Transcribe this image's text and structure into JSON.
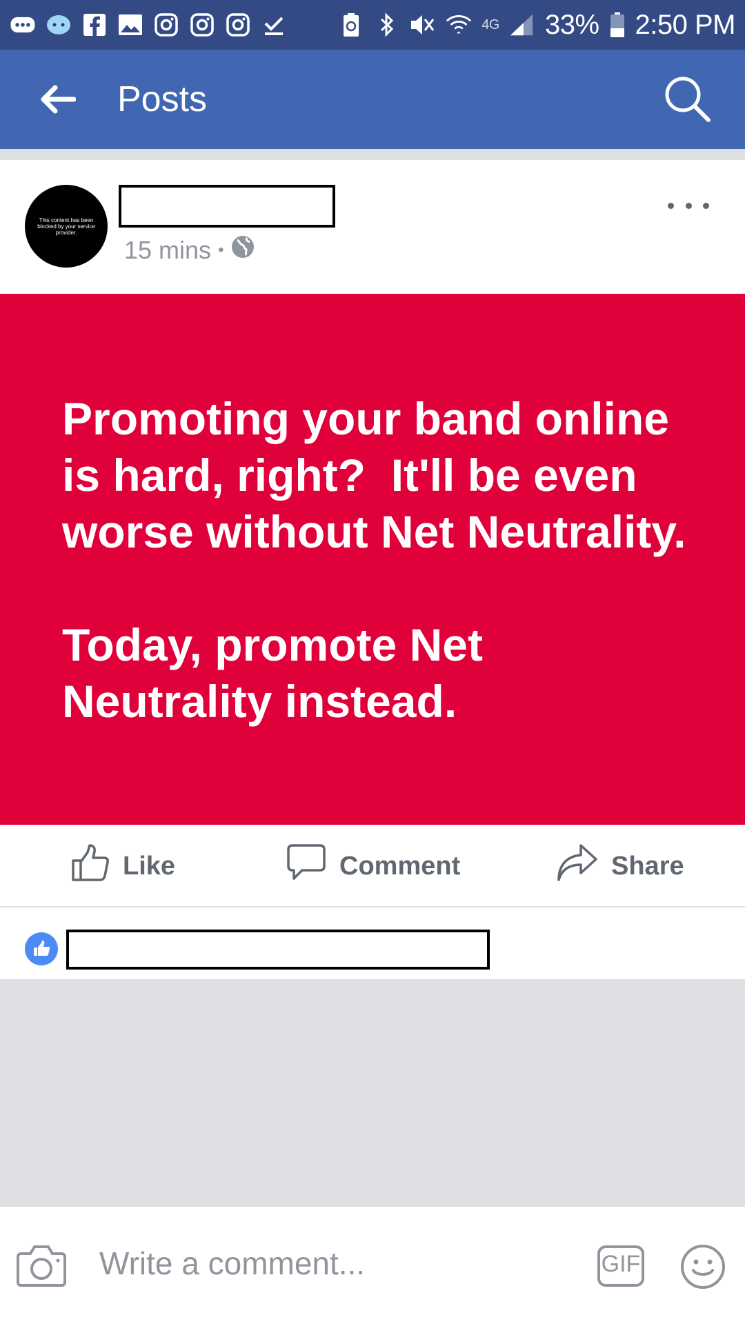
{
  "status_bar": {
    "battery": "33%",
    "time": "2:50 PM",
    "network": "4G",
    "icons_left": [
      "messages-icon",
      "chat-bubble-icon",
      "facebook-icon",
      "gallery-icon",
      "instagram-icon",
      "instagram-icon",
      "instagram-icon",
      "download-done-icon"
    ],
    "icons_right": [
      "battery-saver-icon",
      "bluetooth-icon",
      "mute-icon",
      "wifi-icon",
      "signal-icon",
      "battery-icon"
    ]
  },
  "app_bar": {
    "title": "Posts",
    "back_icon": "arrow-left-icon",
    "search_icon": "search-icon",
    "background": "#4267b2"
  },
  "post": {
    "avatar_text": "This content has been blocked by your service provider.",
    "author_name": "",
    "time": "15 mins",
    "separator": "•",
    "privacy_icon": "globe-icon",
    "more_icon": "more-horizontal-icon",
    "text": "Promoting your band online\nis hard, right?  It'll be even\nworse without Net Neutrality.\n\nToday, promote Net\nNeutrality instead.",
    "background": "#e0003a"
  },
  "actions": {
    "like_label": "Like",
    "comment_label": "Comment",
    "share_label": "Share"
  },
  "reactions": {
    "summary": ""
  },
  "composer": {
    "placeholder": "Write a comment...",
    "gif_label": "GIF"
  }
}
